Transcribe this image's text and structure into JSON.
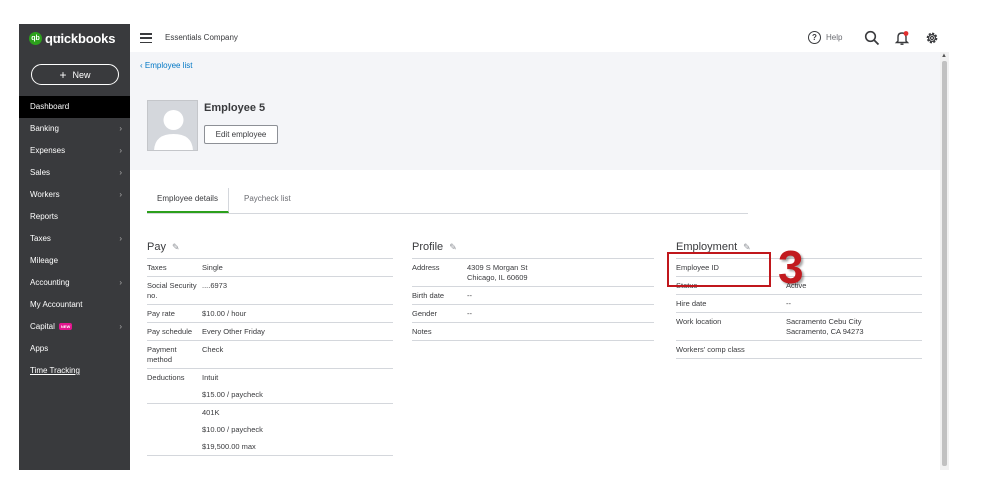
{
  "sidebar": {
    "logo_intuit": "intuit",
    "logo_text": "quickbooks",
    "new_label": "New",
    "items": [
      {
        "label": "Dashboard",
        "chevron": false,
        "active": true
      },
      {
        "label": "Banking",
        "chevron": true
      },
      {
        "label": "Expenses",
        "chevron": true
      },
      {
        "label": "Sales",
        "chevron": true
      },
      {
        "label": "Workers",
        "chevron": true
      },
      {
        "label": "Reports",
        "chevron": false
      },
      {
        "label": "Taxes",
        "chevron": true
      },
      {
        "label": "Mileage",
        "chevron": false
      },
      {
        "label": "Accounting",
        "chevron": true
      },
      {
        "label": "My Accountant",
        "chevron": false
      },
      {
        "label": "Capital",
        "chevron": true,
        "badge": "NEW"
      },
      {
        "label": "Apps",
        "chevron": false
      },
      {
        "label": "Time Tracking",
        "chevron": false
      }
    ]
  },
  "header": {
    "company": "Essentials Company",
    "help_label": "Help",
    "icons": [
      "hamburger-icon",
      "help-icon",
      "search-icon",
      "bell-icon",
      "gear-icon"
    ]
  },
  "employee": {
    "back_link": "Employee list",
    "name": "Employee 5",
    "edit_label": "Edit employee"
  },
  "tabs": [
    "Employee details",
    "Paycheck list"
  ],
  "pay": {
    "title": "Pay",
    "rows": [
      {
        "label": "Taxes",
        "value": "Single"
      },
      {
        "label": "Social Security no.",
        "value": "....6973"
      },
      {
        "label": "Pay rate",
        "value": "$10.00 / hour"
      },
      {
        "label": "Pay schedule",
        "value": "Every Other Friday"
      },
      {
        "label": "Payment method",
        "value": "Check"
      },
      {
        "label": "Deductions",
        "value": "Intuit"
      },
      {
        "label": "",
        "value": "$15.00 / paycheck"
      },
      {
        "label": "",
        "value": "401K"
      },
      {
        "label": "",
        "value": "$10.00 / paycheck"
      },
      {
        "label": "",
        "value": "$19,500.00 max"
      }
    ]
  },
  "profile": {
    "title": "Profile",
    "rows": [
      {
        "label": "Address",
        "value": "4309 S Morgan St",
        "value2": "Chicago, IL 60609"
      },
      {
        "label": "Birth date",
        "value": "--"
      },
      {
        "label": "Gender",
        "value": "--"
      },
      {
        "label": "Notes",
        "value": ""
      }
    ]
  },
  "employment": {
    "title": "Employment",
    "rows": [
      {
        "label": "Employee ID",
        "value": ""
      },
      {
        "label": "Status",
        "value": "Active"
      },
      {
        "label": "Hire date",
        "value": "--"
      },
      {
        "label": "Work location",
        "value": "Sacramento Cebu City",
        "value2": "Sacramento, CA 94273"
      },
      {
        "label": "Workers' comp class",
        "value": ""
      }
    ]
  },
  "annotation": {
    "step_number": "3",
    "callout_color": "#c0171c"
  },
  "colors": {
    "sidebar_bg": "#393a3d",
    "accent_green": "#2ca01c",
    "link_blue": "#0077c5",
    "header_bg": "#f4f5f8"
  }
}
